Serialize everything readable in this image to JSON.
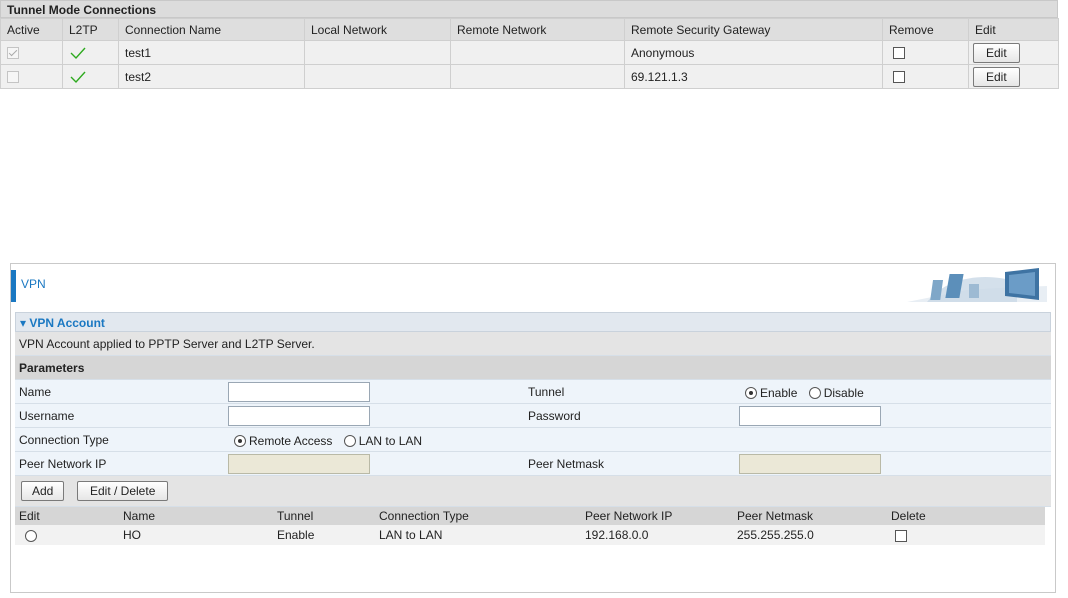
{
  "tunnel": {
    "title": "Tunnel Mode Connections",
    "headers": [
      "Active",
      "L2TP",
      "Connection Name",
      "Local Network",
      "Remote Network",
      "Remote Security Gateway",
      "Remove",
      "Edit"
    ],
    "rows": [
      {
        "active": true,
        "l2tp": true,
        "name": "test1",
        "local": "",
        "remote": "",
        "gateway": "Anonymous",
        "remove": false,
        "edit_label": "Edit"
      },
      {
        "active": false,
        "l2tp": true,
        "name": "test2",
        "local": "",
        "remote": "",
        "gateway": "69.121.1.3",
        "remove": false,
        "edit_label": "Edit"
      }
    ]
  },
  "vpn": {
    "title": "VPN",
    "section_title": "▾ VPN Account",
    "description": "VPN Account applied to PPTP Server and L2TP Server.",
    "params_title": "Parameters",
    "form": {
      "name_label": "Name",
      "name_value": "",
      "tunnel_label": "Tunnel",
      "tunnel_enable": "Enable",
      "tunnel_disable": "Disable",
      "tunnel_selected": "Enable",
      "username_label": "Username",
      "username_value": "",
      "password_label": "Password",
      "password_value": "",
      "conn_type_label": "Connection Type",
      "conn_remote": "Remote Access",
      "conn_lan": "LAN to LAN",
      "conn_selected": "Remote Access",
      "peer_ip_label": "Peer Network IP",
      "peer_mask_label": "Peer Netmask"
    },
    "buttons": {
      "add": "Add",
      "edit_delete": "Edit / Delete"
    },
    "accounts": {
      "headers": [
        "Edit",
        "Name",
        "Tunnel",
        "Connection Type",
        "Peer Network IP",
        "Peer Netmask",
        "Delete"
      ],
      "rows": [
        {
          "name": "HO",
          "tunnel": "Enable",
          "type": "LAN to LAN",
          "peer_ip": "192.168.0.0",
          "peer_mask": "255.255.255.0",
          "selected": false,
          "delete": false
        }
      ]
    }
  },
  "colors": {
    "accent": "#1a78c2",
    "check": "#2eaa1f"
  }
}
